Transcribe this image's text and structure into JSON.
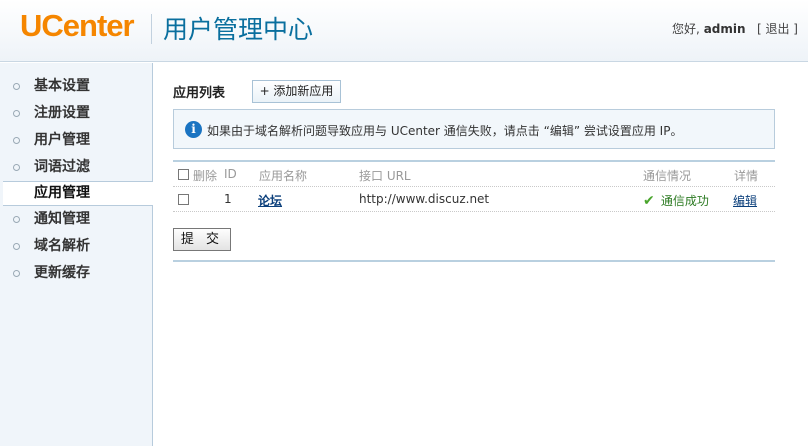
{
  "header": {
    "logo_u": "U",
    "logo_rest": "Center",
    "title": "用户管理中心",
    "greeting": "您好, ",
    "username": "admin",
    "logout": "[ 退出 ]"
  },
  "sidebar": {
    "items": [
      {
        "label": "基本设置"
      },
      {
        "label": "注册设置"
      },
      {
        "label": "用户管理"
      },
      {
        "label": "词语过滤"
      },
      {
        "label": "应用管理"
      },
      {
        "label": "通知管理"
      },
      {
        "label": "域名解析"
      },
      {
        "label": "更新缓存"
      }
    ],
    "active_index": 4
  },
  "main": {
    "section_title": "应用列表",
    "add_button": "+ 添加新应用",
    "notice": "如果由于域名解析问题导致应用与 UCenter 通信失败，请点击 “编辑” 尝试设置应用 IP。",
    "table": {
      "headers": {
        "delete": "删除",
        "id": "ID",
        "name": "应用名称",
        "url": "接口 URL",
        "status": "通信情况",
        "detail": "详情"
      },
      "rows": [
        {
          "id": "1",
          "name": "论坛",
          "url": "http://www.discuz.net",
          "status": "通信成功",
          "detail": "编辑"
        }
      ]
    },
    "submit_button": "提 交"
  },
  "colors": {
    "brand_orange": "#f58600",
    "title_blue": "#0a6f9e",
    "link_blue": "#0b3f7b",
    "success_green": "#4aa52d"
  }
}
